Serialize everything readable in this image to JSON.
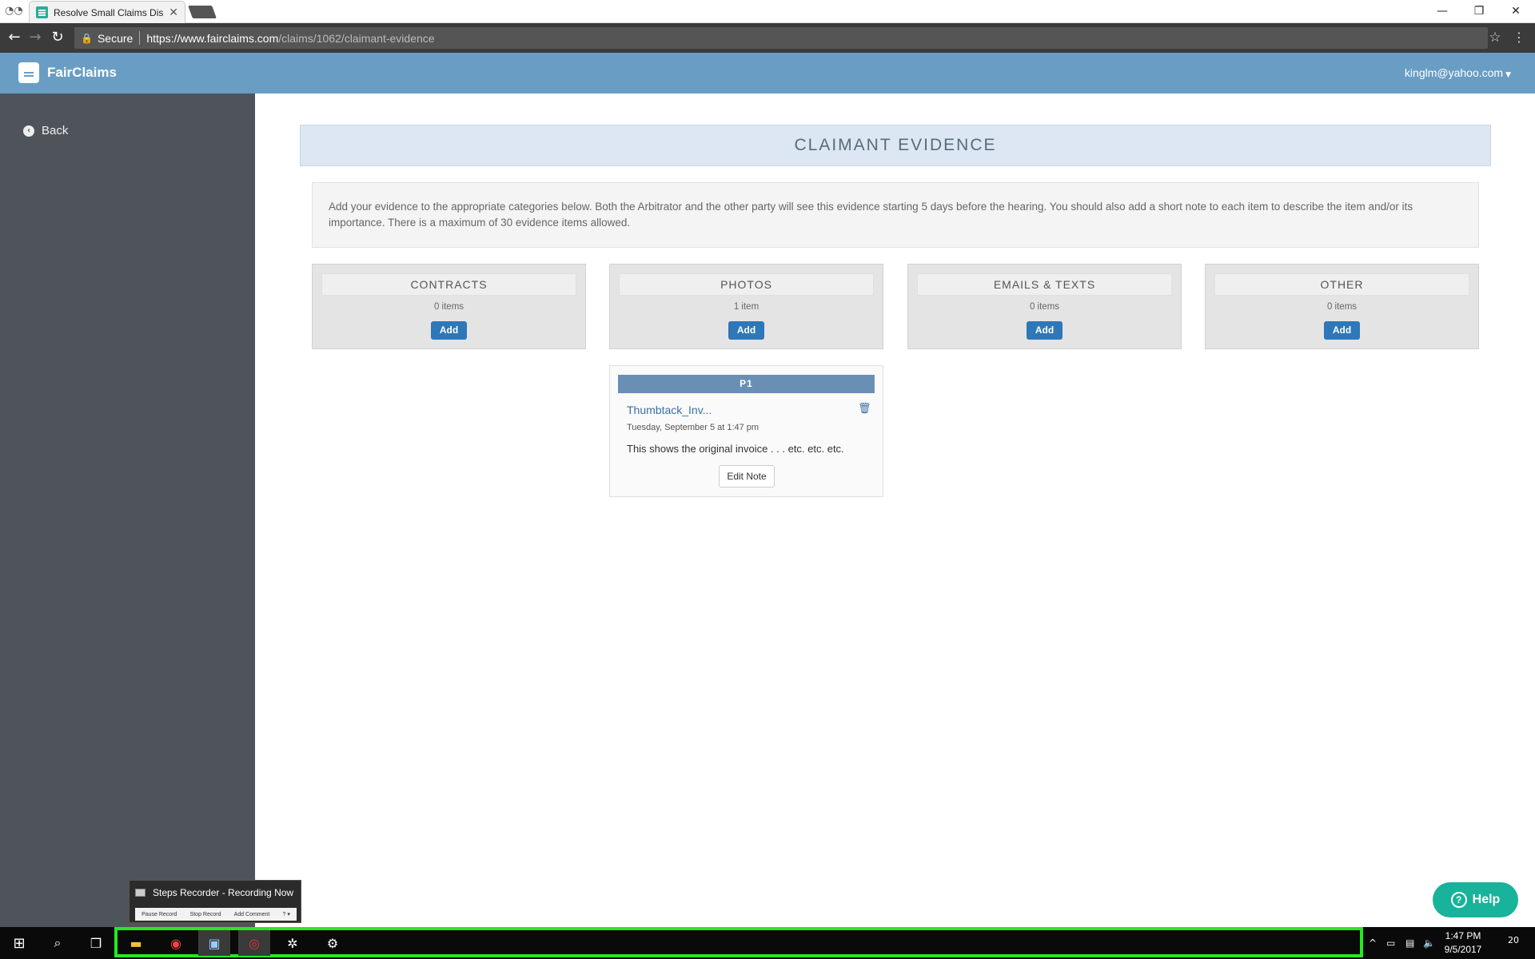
{
  "browser": {
    "tab_title": "Resolve Small Claims Dis",
    "secure_label": "Secure",
    "url_host": "https://www.fairclaims.com",
    "url_path": "/claims/1062/claimant-evidence"
  },
  "app": {
    "brand": "FairClaims",
    "user_email": "kinglm@yahoo.com",
    "back_label": "Back",
    "page_title": "CLAIMANT EVIDENCE",
    "intro": "Add your evidence to the appropriate categories below. Both the Arbitrator and the other party will see this evidence starting 5 days before the hearing. You should also add a short note to each item to describe the item and/or its importance. There is a maximum of 30 evidence items allowed.",
    "categories": [
      {
        "name": "CONTRACTS",
        "count": "0 items",
        "add": "Add"
      },
      {
        "name": "PHOTOS",
        "count": "1 item",
        "add": "Add"
      },
      {
        "name": "EMAILS & TEXTS",
        "count": "0 items",
        "add": "Add"
      },
      {
        "name": "OTHER",
        "count": "0 items",
        "add": "Add"
      }
    ],
    "evidence_item": {
      "label": "P1",
      "file_name": "Thumbtack_Inv...",
      "date": "Tuesday, September 5 at 1:47 pm",
      "note": "This shows the original invoice . . . etc. etc. etc.",
      "edit_label": "Edit Note"
    },
    "help_label": "Help"
  },
  "steps_recorder": {
    "title": "Steps Recorder - Recording Now",
    "pause": "Pause Record",
    "stop": "Stop Record",
    "comment": "Add Comment"
  },
  "taskbar": {
    "time": "1:47 PM",
    "date": "9/5/2017",
    "notifications": "20"
  },
  "colors": {
    "header": "#6a9dc4",
    "sidebar": "#4f545b",
    "primary_button": "#2e77b8",
    "help_button": "#17b39a",
    "highlight": "#25e825"
  }
}
